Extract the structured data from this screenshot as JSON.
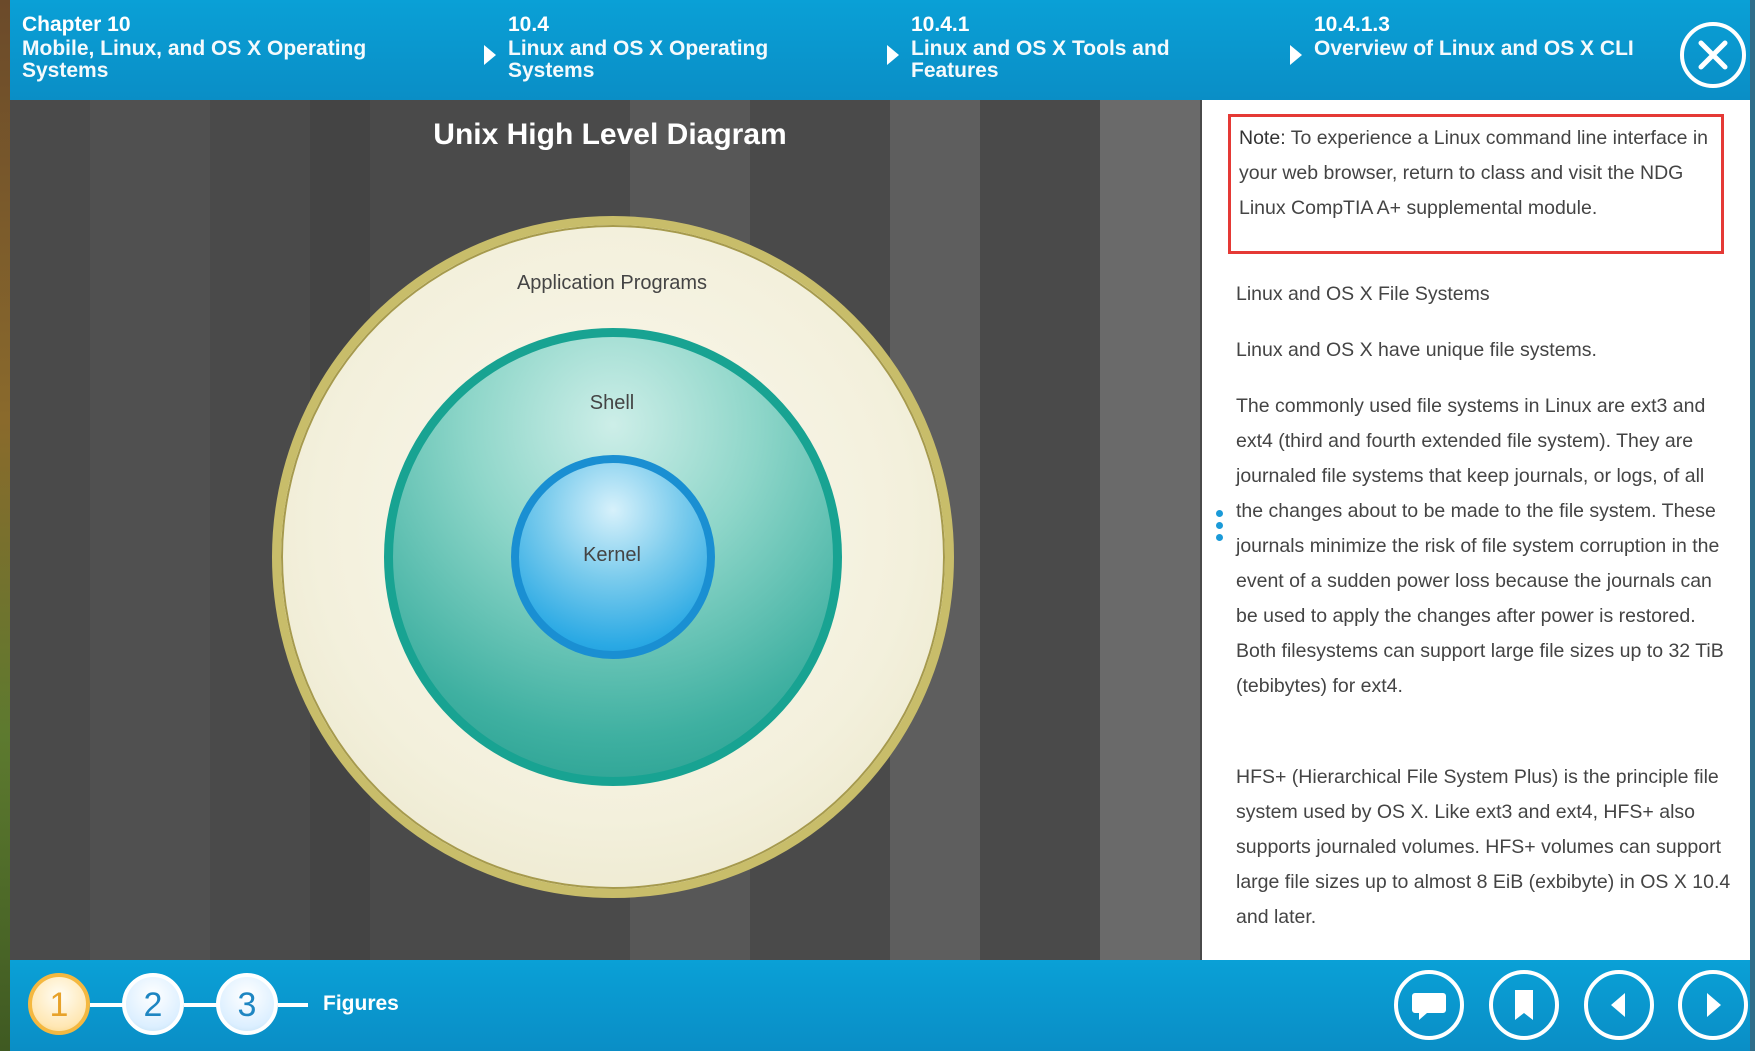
{
  "header": {
    "crumbs": [
      {
        "num": "Chapter 10",
        "title": "Mobile, Linux, and OS X Operating Systems"
      },
      {
        "num": "10.4",
        "title": "Linux and OS X Operating Systems"
      },
      {
        "num": "10.4.1",
        "title": "Linux and OS X Tools and Features"
      },
      {
        "num": "10.4.1.3",
        "title": "Overview of Linux and OS X CLI"
      }
    ],
    "close_icon": "close-icon"
  },
  "diagram": {
    "title": "Unix High Level Diagram",
    "layers": {
      "outer": "Application Programs",
      "middle": "Shell",
      "inner": "Kernel"
    }
  },
  "panel": {
    "note_label": "Note:",
    "note_text": "To experience a Linux command line interface in your web browser, return to class and visit the NDG Linux CompTIA A+ supplemental module.",
    "heading": "Linux and OS X File Systems",
    "p1": "Linux and OS X have unique file systems.",
    "p2": "The commonly used file systems in Linux are ext3 and ext4 (third and fourth extended file system). They are journaled file systems that keep journals, or logs, of all the changes about to be made to the file system. These journals minimize the risk of file system corruption in the event of a sudden power loss because the journals can be used to apply the changes after power is restored. Both filesystems can support large file sizes up to 32 TiB (tebibytes) for ext4.",
    "p3": "HFS+ (Hierarchical File System Plus) is the principle file system used by OS X. Like ext3 and ext4, HFS+ also supports journaled volumes. HFS+ volumes can support large file sizes up to almost 8 EiB (exbibyte) in OS X 10.4 and later."
  },
  "footer": {
    "steps": [
      "1",
      "2",
      "3"
    ],
    "active_step": "1",
    "figures_label": "Figures",
    "nav_icons": [
      "comment-icon",
      "bookmark-icon",
      "previous-icon",
      "next-icon"
    ]
  },
  "colors": {
    "accent": "#0a9bd3",
    "note_border": "#e53935",
    "active_step": "#f4b840"
  }
}
